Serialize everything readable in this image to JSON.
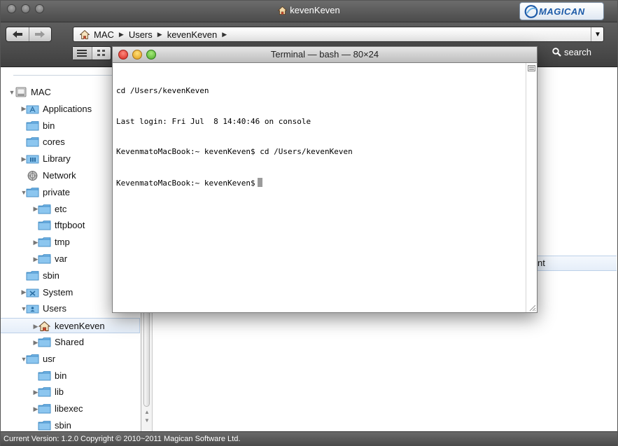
{
  "window": {
    "title": "kevenKeven",
    "brand": "MAGICAN"
  },
  "path_bar": {
    "crumbs": [
      "MAC",
      "Users",
      "kevenKeven"
    ]
  },
  "toolbar": {
    "search_label": "search"
  },
  "sidebar": {
    "items": [
      {
        "label": "MAC",
        "icon": "drive-icon",
        "level": 0,
        "state": "expanded"
      },
      {
        "label": "Applications",
        "icon": "applications-folder-icon",
        "level": 1,
        "state": "collapsed"
      },
      {
        "label": "bin",
        "icon": "folder-icon",
        "level": 1,
        "state": "none"
      },
      {
        "label": "cores",
        "icon": "folder-icon",
        "level": 1,
        "state": "none"
      },
      {
        "label": "Library",
        "icon": "library-folder-icon",
        "level": 1,
        "state": "collapsed"
      },
      {
        "label": "Network",
        "icon": "network-icon",
        "level": 1,
        "state": "none"
      },
      {
        "label": "private",
        "icon": "folder-icon",
        "level": 1,
        "state": "expanded"
      },
      {
        "label": "etc",
        "icon": "folder-icon",
        "level": 2,
        "state": "collapsed"
      },
      {
        "label": "tftpboot",
        "icon": "folder-icon",
        "level": 2,
        "state": "none"
      },
      {
        "label": "tmp",
        "icon": "folder-icon",
        "level": 2,
        "state": "collapsed"
      },
      {
        "label": "var",
        "icon": "folder-icon",
        "level": 2,
        "state": "collapsed"
      },
      {
        "label": "sbin",
        "icon": "folder-icon",
        "level": 1,
        "state": "none"
      },
      {
        "label": "System",
        "icon": "system-folder-icon",
        "level": 1,
        "state": "collapsed"
      },
      {
        "label": "Users",
        "icon": "users-folder-icon",
        "level": 1,
        "state": "expanded"
      },
      {
        "label": "kevenKeven",
        "icon": "home-icon",
        "level": 2,
        "state": "collapsed",
        "selected": true
      },
      {
        "label": "Shared",
        "icon": "folder-icon",
        "level": 2,
        "state": "collapsed"
      },
      {
        "label": "usr",
        "icon": "folder-icon",
        "level": 1,
        "state": "expanded"
      },
      {
        "label": "bin",
        "icon": "folder-icon",
        "level": 2,
        "state": "none"
      },
      {
        "label": "lib",
        "icon": "folder-icon",
        "level": 2,
        "state": "collapsed"
      },
      {
        "label": "libexec",
        "icon": "folder-icon",
        "level": 2,
        "state": "collapsed"
      },
      {
        "label": "sbin",
        "icon": "folder-icon",
        "level": 2,
        "state": "none"
      }
    ]
  },
  "content": {
    "partial_row_text": "nt"
  },
  "terminal": {
    "title": "Terminal — bash — 80×24",
    "lines": [
      "cd /Users/kevenKeven",
      "Last login: Fri Jul  8 14:40:46 on console",
      "KevenmatoMacBook:~ kevenKeven$ cd /Users/kevenKeven",
      "KevenmatoMacBook:~ kevenKeven$"
    ]
  },
  "status_bar": {
    "text": "Current Version: 1.2.0 Copyright © 2010~2011 Magican Software Ltd."
  },
  "colors": {
    "folder": "#6fb3e6",
    "selection": "#e5eef9",
    "close": "#d6271d",
    "minimize": "#e09b16",
    "zoom": "#4eab2b"
  }
}
